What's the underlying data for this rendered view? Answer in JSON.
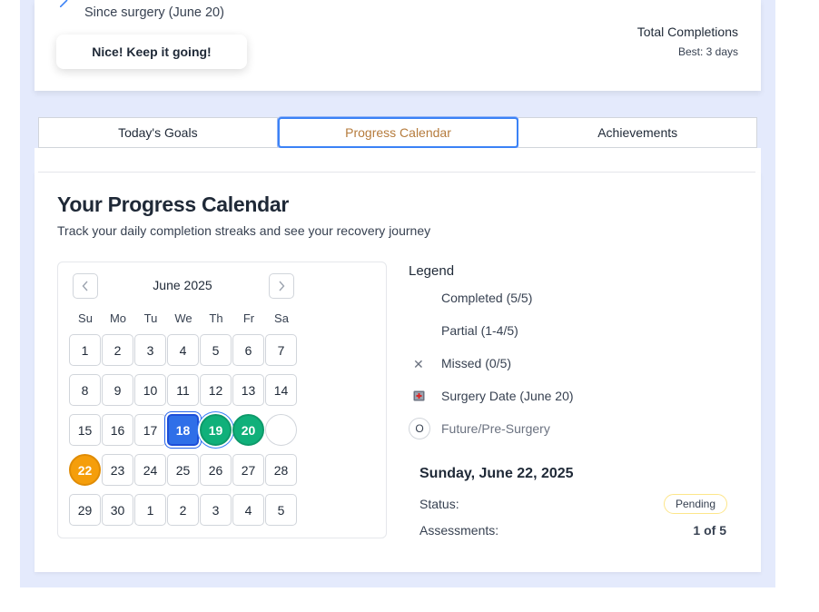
{
  "header": {
    "since": "Since surgery (June 20)",
    "encouragement": "Nice! Keep it going!",
    "total_label": "Total Completions",
    "best": "Best: 3 days"
  },
  "tabs": [
    {
      "label": "Today's Goals",
      "active": false
    },
    {
      "label": "Progress Calendar",
      "active": true
    },
    {
      "label": "Achievements",
      "active": false
    }
  ],
  "main": {
    "title": "Your Progress Calendar",
    "subtitle": "Track your daily completion streaks and see your recovery journey"
  },
  "calendar": {
    "month": "June 2025",
    "prev_icon": "chevron-left-icon",
    "next_icon": "chevron-right-icon",
    "weekdays": [
      "Su",
      "Mo",
      "Tu",
      "We",
      "Th",
      "Fr",
      "Sa"
    ],
    "weeks": [
      [
        {
          "d": "1"
        },
        {
          "d": "2"
        },
        {
          "d": "3"
        },
        {
          "d": "4"
        },
        {
          "d": "5"
        },
        {
          "d": "6"
        },
        {
          "d": "7"
        }
      ],
      [
        {
          "d": "8"
        },
        {
          "d": "9"
        },
        {
          "d": "10"
        },
        {
          "d": "11"
        },
        {
          "d": "12"
        },
        {
          "d": "13"
        },
        {
          "d": "14"
        }
      ],
      [
        {
          "d": "15"
        },
        {
          "d": "16"
        },
        {
          "d": "17"
        },
        {
          "d": "18",
          "state": "selected"
        },
        {
          "d": "19",
          "state": "completed-ring"
        },
        {
          "d": "20",
          "state": "completed"
        },
        {
          "d": "",
          "state": "future-empty"
        }
      ],
      [
        {
          "d": "22",
          "state": "today"
        },
        {
          "d": "23"
        },
        {
          "d": "24"
        },
        {
          "d": "25"
        },
        {
          "d": "26"
        },
        {
          "d": "27"
        },
        {
          "d": "28"
        }
      ],
      [
        {
          "d": "29"
        },
        {
          "d": "30"
        },
        {
          "d": "1"
        },
        {
          "d": "2"
        },
        {
          "d": "3"
        },
        {
          "d": "4"
        },
        {
          "d": "5"
        }
      ]
    ]
  },
  "legend": {
    "title": "Legend",
    "completed": "Completed (5/5)",
    "partial": "Partial (1-4/5)",
    "missed_icon": "x-icon",
    "missed": "Missed (0/5)",
    "surgery_icon": "hospital-icon",
    "surgery": "Surgery Date (June 20)",
    "future_icon": "circle-icon",
    "future_glyph": "O",
    "future": "Future/Pre-Surgery"
  },
  "detail": {
    "date": "Sunday, June 22, 2025",
    "status_label": "Status:",
    "status_value": "Pending",
    "assess_label": "Assessments:",
    "assess_value": "1 of 5"
  },
  "colors": {
    "accent": "#2f6fe8",
    "completed": "#10b07a",
    "today": "#f59e0b",
    "active_tab_text": "#b57b3c"
  }
}
